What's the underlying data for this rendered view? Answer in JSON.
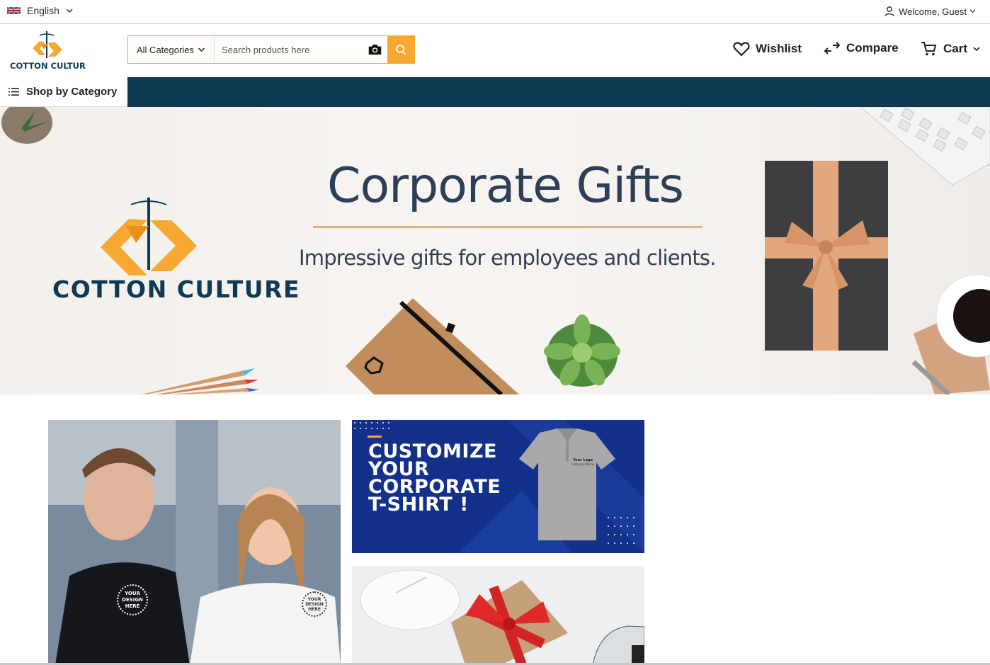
{
  "topbar": {
    "language": "English",
    "welcome": "Welcome, Guest"
  },
  "header": {
    "logo_text": "COTTON CULTURE",
    "search": {
      "category": "All Categories",
      "placeholder": "Search products here"
    },
    "wishlist": "Wishlist",
    "compare": "Compare",
    "cart": "Cart"
  },
  "navbar": {
    "shop_by_category": "Shop by Category"
  },
  "hero": {
    "title": "Corporate Gifts",
    "subtitle": "Impressive gifts for employees and clients.",
    "logo_text": "COTTON CULTURE"
  },
  "tiles": {
    "tshirt_lines": [
      "CUSTOMIZE",
      "YOUR",
      "CORPORATE",
      "T-SHIRT !"
    ],
    "shirt_logo": "Your Logo",
    "shirt_company": "Company Name",
    "badge": "YOUR DESIGN HERE"
  },
  "colors": {
    "accent": "#f7a830",
    "navbar": "#0f3a53",
    "brand_navy": "#2d3e57"
  }
}
